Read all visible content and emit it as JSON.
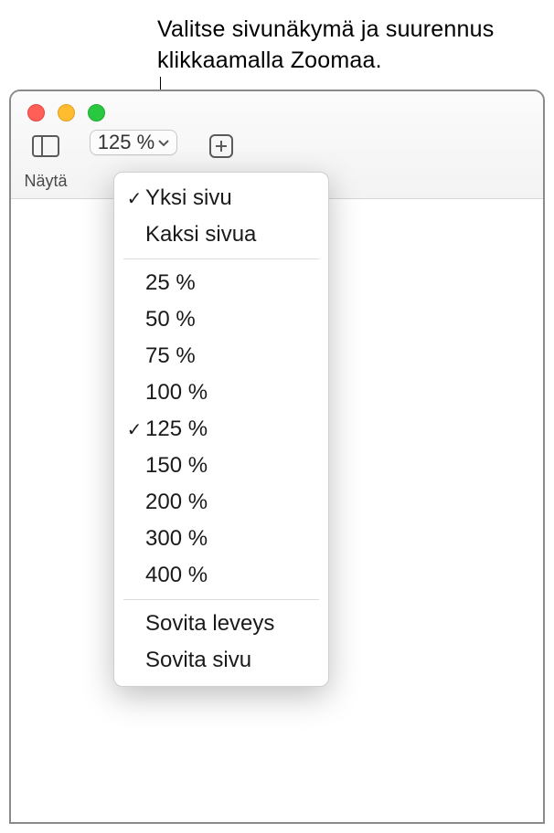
{
  "callout": {
    "line1": "Valitse sivunäkymä ja suurennus",
    "line2": "klikkaamalla Zoomaa."
  },
  "toolbar": {
    "view_label": "Näytä",
    "zoom_current": "125 %"
  },
  "menu": {
    "page_views": [
      {
        "label": "Yksi sivu",
        "checked": true
      },
      {
        "label": "Kaksi sivua",
        "checked": false
      }
    ],
    "zoom_levels": [
      {
        "label": "25 %",
        "checked": false
      },
      {
        "label": "50 %",
        "checked": false
      },
      {
        "label": "75 %",
        "checked": false
      },
      {
        "label": "100 %",
        "checked": false
      },
      {
        "label": "125 %",
        "checked": true
      },
      {
        "label": "150 %",
        "checked": false
      },
      {
        "label": "200 %",
        "checked": false
      },
      {
        "label": "300 %",
        "checked": false
      },
      {
        "label": "400 %",
        "checked": false
      }
    ],
    "fit_options": [
      {
        "label": "Sovita leveys",
        "checked": false
      },
      {
        "label": "Sovita sivu",
        "checked": false
      }
    ]
  }
}
